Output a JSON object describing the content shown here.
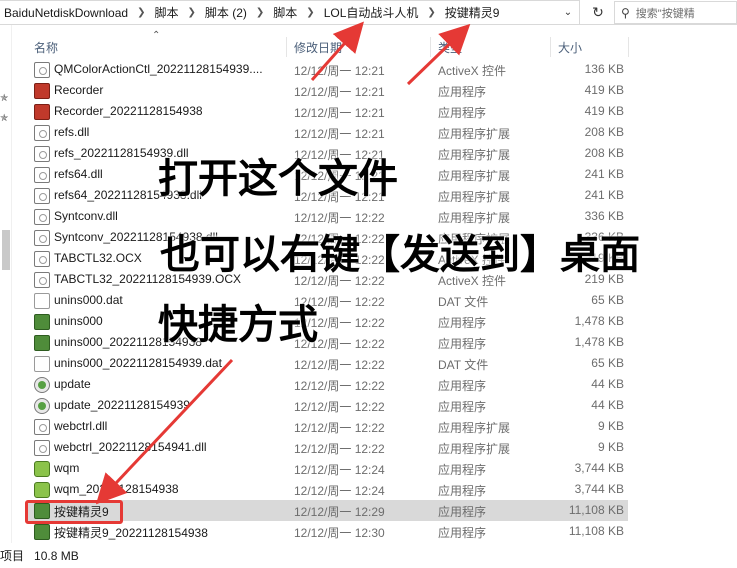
{
  "address_bar": {
    "crumbs": [
      "BaiduNetdiskDownload",
      "脚本",
      "脚本 (2)",
      "脚本",
      "LOL自动战斗人机",
      "按键精灵9"
    ],
    "search_placeholder": "搜索\"按键精"
  },
  "columns": {
    "name": "名称",
    "date": "修改日期",
    "type": "类型",
    "size": "大小"
  },
  "files": [
    {
      "name": "QMColorActionCtl_20221128154939....",
      "date": "12/12/周一 12:21",
      "type": "ActiveX 控件",
      "size": "136 KB",
      "icon": "doc"
    },
    {
      "name": "Recorder",
      "date": "12/12/周一 12:21",
      "type": "应用程序",
      "size": "419 KB",
      "icon": "rec"
    },
    {
      "name": "Recorder_20221128154938",
      "date": "12/12/周一 12:21",
      "type": "应用程序",
      "size": "419 KB",
      "icon": "rec"
    },
    {
      "name": "refs.dll",
      "date": "12/12/周一 12:21",
      "type": "应用程序扩展",
      "size": "208 KB",
      "icon": "doc"
    },
    {
      "name": "refs_20221128154939.dll",
      "date": "12/12/周一 12:21",
      "type": "应用程序扩展",
      "size": "208 KB",
      "icon": "doc"
    },
    {
      "name": "refs64.dll",
      "date": "12/12/周一 12:21",
      "type": "应用程序扩展",
      "size": "241 KB",
      "icon": "doc"
    },
    {
      "name": "refs64_20221128154938.dll",
      "date": "12/12/周一 12:21",
      "type": "应用程序扩展",
      "size": "241 KB",
      "icon": "doc"
    },
    {
      "name": "Syntconv.dll",
      "date": "12/12/周一 12:22",
      "type": "应用程序扩展",
      "size": "336 KB",
      "icon": "doc"
    },
    {
      "name": "Syntconv_20221128154938.dll",
      "date": "12/12/周一 12:22",
      "type": "应用程序扩展",
      "size": "336 KB",
      "icon": "doc"
    },
    {
      "name": "TABCTL32.OCX",
      "date": "12/12/周一 12:22",
      "type": "ActiveX 控件",
      "size": "219 KB",
      "icon": "doc"
    },
    {
      "name": "TABCTL32_20221128154939.OCX",
      "date": "12/12/周一 12:22",
      "type": "ActiveX 控件",
      "size": "219 KB",
      "icon": "doc"
    },
    {
      "name": "unins000.dat",
      "date": "12/12/周一 12:22",
      "type": "DAT 文件",
      "size": "65 KB",
      "icon": "plain"
    },
    {
      "name": "unins000",
      "date": "12/12/周一 12:22",
      "type": "应用程序",
      "size": "1,478 KB",
      "icon": "app"
    },
    {
      "name": "unins000_20221128154938",
      "date": "12/12/周一 12:22",
      "type": "应用程序",
      "size": "1,478 KB",
      "icon": "app"
    },
    {
      "name": "unins000_20221128154939.dat",
      "date": "12/12/周一 12:22",
      "type": "DAT 文件",
      "size": "65 KB",
      "icon": "plain"
    },
    {
      "name": "update",
      "date": "12/12/周一 12:22",
      "type": "应用程序",
      "size": "44 KB",
      "icon": "ball"
    },
    {
      "name": "update_20221128154939",
      "date": "12/12/周一 12:22",
      "type": "应用程序",
      "size": "44 KB",
      "icon": "ball"
    },
    {
      "name": "webctrl.dll",
      "date": "12/12/周一 12:22",
      "type": "应用程序扩展",
      "size": "9 KB",
      "icon": "doc"
    },
    {
      "name": "webctrl_20221128154941.dll",
      "date": "12/12/周一 12:22",
      "type": "应用程序扩展",
      "size": "9 KB",
      "icon": "doc"
    },
    {
      "name": "wqm",
      "date": "12/12/周一 12:24",
      "type": "应用程序",
      "size": "3,744 KB",
      "icon": "green"
    },
    {
      "name": "wqm_20221128154938",
      "date": "12/12/周一 12:24",
      "type": "应用程序",
      "size": "3,744 KB",
      "icon": "green"
    },
    {
      "name": "按键精灵9",
      "date": "12/12/周一 12:29",
      "type": "应用程序",
      "size": "11,108 KB",
      "icon": "app",
      "selected": true
    },
    {
      "name": "按键精灵9_20221128154938",
      "date": "12/12/周一 12:30",
      "type": "应用程序",
      "size": "11,108 KB",
      "icon": "app"
    }
  ],
  "status_bar": {
    "items_label": "项目",
    "selected_size": "10.8 MB"
  },
  "overlay_captions": [
    "打开这个文件",
    "也可以右键【发送到】桌面",
    "快捷方式"
  ],
  "colors": {
    "arrow": "#e53935",
    "selection": "#d9d9d9",
    "header_text": "#4c607a"
  }
}
